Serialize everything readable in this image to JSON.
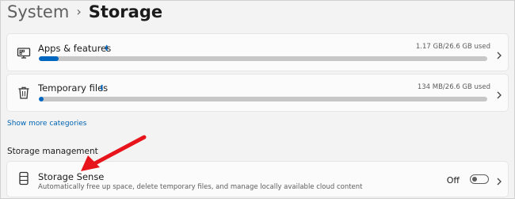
{
  "breadcrumb": {
    "parent": "System",
    "separator": "›",
    "current": "Storage"
  },
  "categories": [
    {
      "label": "Apps & features",
      "usage": "1.17 GB/26.6 GB used",
      "fill_fraction": 0.044,
      "icon": "apps-features-icon"
    },
    {
      "label": "Temporary files",
      "usage": "134 MB/26.6 GB used",
      "fill_fraction": 0.005,
      "icon": "trash-icon"
    }
  ],
  "show_more_link": "Show more categories",
  "section_title": "Storage management",
  "storage_sense": {
    "title": "Storage Sense",
    "description": "Automatically free up space, delete temporary files, and manage locally available cloud content",
    "toggle_label": "Off",
    "toggle_on": false,
    "icon": "storage-drive-icon"
  },
  "colors": {
    "accent": "#0067c0",
    "annotation_arrow": "#e8141b",
    "link": "#0063b1"
  }
}
